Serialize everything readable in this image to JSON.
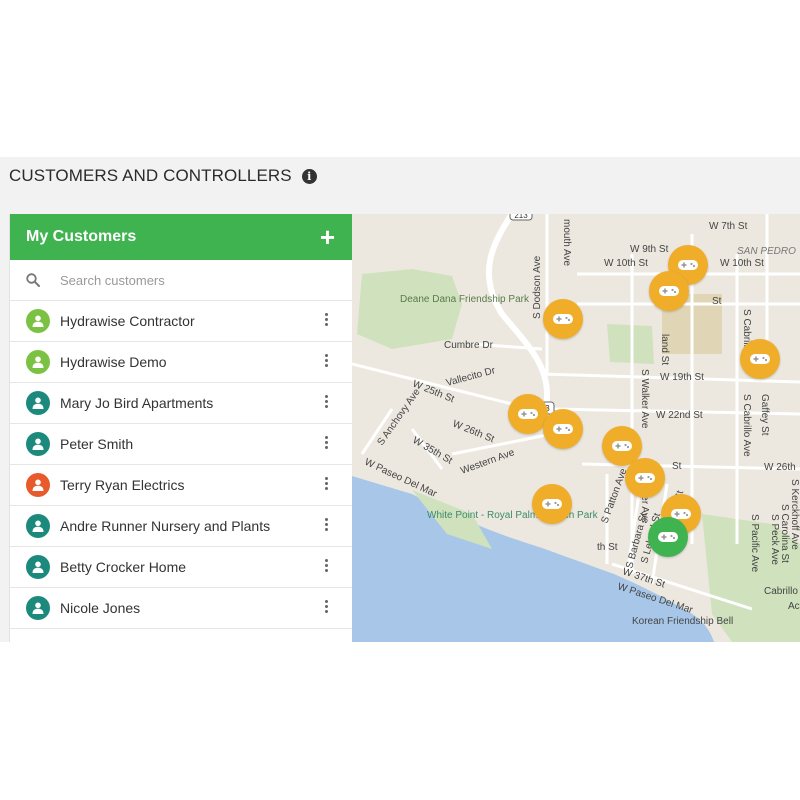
{
  "page": {
    "title": "CUSTOMERS AND CONTROLLERS"
  },
  "panel": {
    "title": "My Customers"
  },
  "search": {
    "placeholder": "Search customers"
  },
  "customers": [
    {
      "name": "Hydrawise Contractor",
      "color": "#7cc242"
    },
    {
      "name": "Hydrawise Demo",
      "color": "#7cc242"
    },
    {
      "name": "Mary Jo Bird Apartments",
      "color": "#1b8a7c"
    },
    {
      "name": "Peter Smith",
      "color": "#1b8a7c"
    },
    {
      "name": "Terry Ryan Electrics",
      "color": "#e8592b"
    },
    {
      "name": "Andre Runner Nursery and Plants",
      "color": "#1b8a7c"
    },
    {
      "name": "Betty Crocker Home",
      "color": "#1b8a7c"
    },
    {
      "name": "Nicole Jones",
      "color": "#1b8a7c"
    }
  ],
  "colors": {
    "brand": "#3fb34f",
    "marker": "#f0ad2a",
    "marker_active": "#3fb34f"
  },
  "map": {
    "places": {
      "park": "Deane Dana Friendship Park",
      "beach": "White Point - Royal Palms Beach Park",
      "landmark": "Korean Friendship Bell",
      "district": "SAN PEDRO"
    },
    "streets": [
      "W 9th St",
      "W 7th St",
      "W 10th St",
      "W 10th St",
      "Cumbre Dr",
      "W 19th St",
      "W 25th St",
      "Vallecito Dr",
      "W 22nd St",
      "W 26th St",
      "W 35th St",
      "W Paseo Del Mar",
      "Western Ave",
      "S Anchovy Ave",
      "W 37th St",
      "W Paseo Del Mar",
      "S Dodson Ave",
      "S Walker Ave",
      "S Cabrillo Ave",
      "S Patton Ave",
      "S Walker Ave",
      "S Barbara St",
      "S Leland St",
      "S Alma St",
      "S Pacific Ave",
      "S Peck Ave",
      "S Kerckhoff Ave",
      "S Carolina St",
      "S Cabrillo Ave",
      "W 26th",
      "Cabrillo",
      "Gaffey St",
      "mouth Ave",
      "land St",
      "th St",
      "St",
      "St",
      "Ac"
    ],
    "route_shields": [
      "213",
      "213"
    ],
    "marker_icon": "gamepad-icon"
  }
}
